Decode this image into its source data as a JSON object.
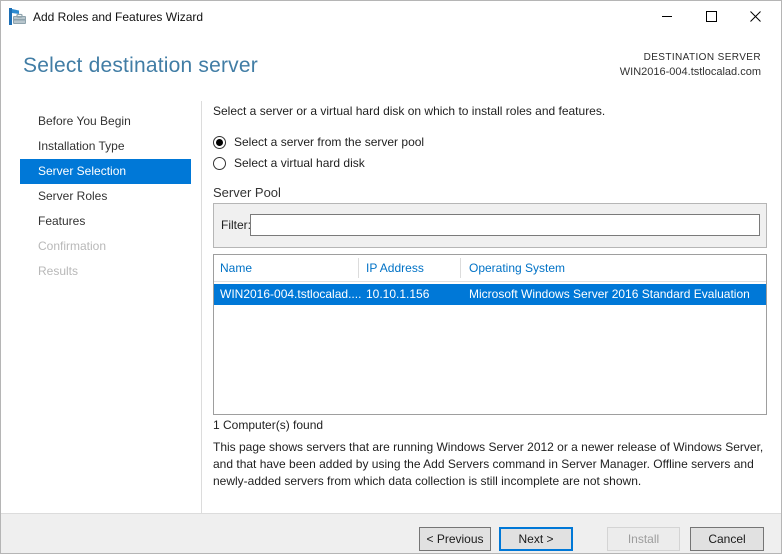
{
  "window": {
    "title": "Add Roles and Features Wizard",
    "icons": {
      "app": "toolbox-icon",
      "minimize": "minimize-icon",
      "maximize": "maximize-icon",
      "close": "close-icon"
    }
  },
  "header": {
    "title": "Select destination server",
    "destination_label": "DESTINATION SERVER",
    "destination_server": "WIN2016-004.tstlocalad.com"
  },
  "sidebar": {
    "items": [
      {
        "label": "Before You Begin",
        "state": "enabled"
      },
      {
        "label": "Installation Type",
        "state": "enabled"
      },
      {
        "label": "Server Selection",
        "state": "selected"
      },
      {
        "label": "Server Roles",
        "state": "enabled"
      },
      {
        "label": "Features",
        "state": "enabled"
      },
      {
        "label": "Confirmation",
        "state": "disabled"
      },
      {
        "label": "Results",
        "state": "disabled"
      }
    ]
  },
  "main": {
    "instruction": "Select a server or a virtual hard disk on which to install roles and features.",
    "radios": [
      {
        "label": "Select a server from the server pool",
        "selected": true
      },
      {
        "label": "Select a virtual hard disk",
        "selected": false
      }
    ],
    "server_pool": {
      "title": "Server Pool",
      "filter_label": "Filter:",
      "filter_value": "",
      "table": {
        "columns": [
          "Name",
          "IP Address",
          "Operating System"
        ],
        "rows": [
          {
            "name": "WIN2016-004.tstlocalad....",
            "ip": "10.10.1.156",
            "os": "Microsoft Windows Server 2016 Standard Evaluation",
            "selected": true
          }
        ]
      },
      "count_text": "1 Computer(s) found"
    },
    "description": "This page shows servers that are running Windows Server 2012 or a newer release of Windows Server, and that have been added by using the Add Servers command in Server Manager. Offline servers and newly-added servers from which data collection is still incomplete are not shown."
  },
  "footer": {
    "buttons": [
      {
        "label": "< Previous",
        "state": "normal"
      },
      {
        "label": "Next >",
        "state": "default"
      },
      {
        "label": "Install",
        "state": "disabled"
      },
      {
        "label": "Cancel",
        "state": "normal"
      }
    ]
  },
  "colors": {
    "accent": "#0078d7",
    "heading": "#417da5",
    "table_header_text": "#0072c6",
    "footer_bg": "#efefef",
    "disabled_text": "#b8b8b8"
  }
}
